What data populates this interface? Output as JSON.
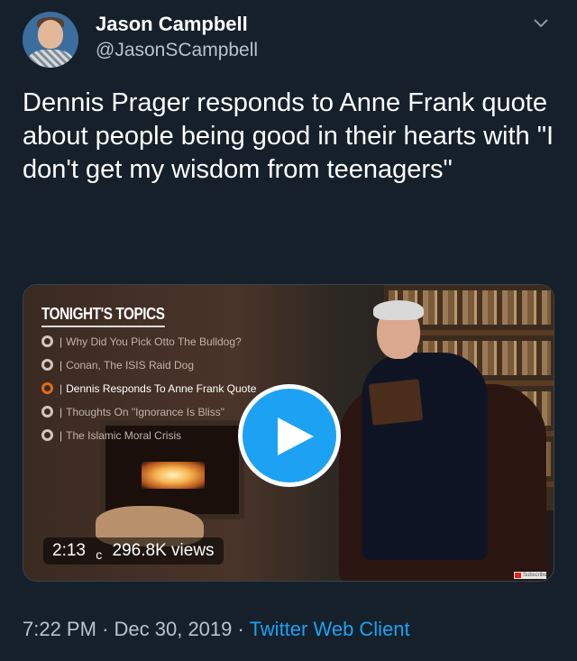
{
  "author": {
    "name": "Jason Campbell",
    "handle": "@JasonSCampbell"
  },
  "tweet": {
    "text": "Dennis Prager responds to Anne Frank quote about people being good in their hearts with \"I don't get my wisdom from teenagers\""
  },
  "video": {
    "topics_title": "TONIGHT'S TOPICS",
    "topics": [
      "Why Did You Pick Otto The Bulldog?",
      "Conan, The ISIS Raid Dog",
      "Dennis Responds To Anne Frank Quote",
      "Thoughts On \"Ignorance Is Bliss\"",
      "The Islamic Moral Crisis"
    ],
    "active_topic_index": 2,
    "duration": "2:13",
    "separator": "c",
    "views": "296.8K views",
    "subscribe_badge": "Subscribe"
  },
  "meta": {
    "time": "7:22 PM",
    "date": "Dec 30, 2019",
    "dot": "·",
    "client": "Twitter Web Client"
  },
  "colors": {
    "background": "#15202b",
    "accent": "#1da1f2",
    "secondary_text": "#b8c3cd",
    "active_topic_ring": "#e36a1e"
  },
  "icons": [
    "chevron-down-icon",
    "play-icon",
    "avatar"
  ]
}
